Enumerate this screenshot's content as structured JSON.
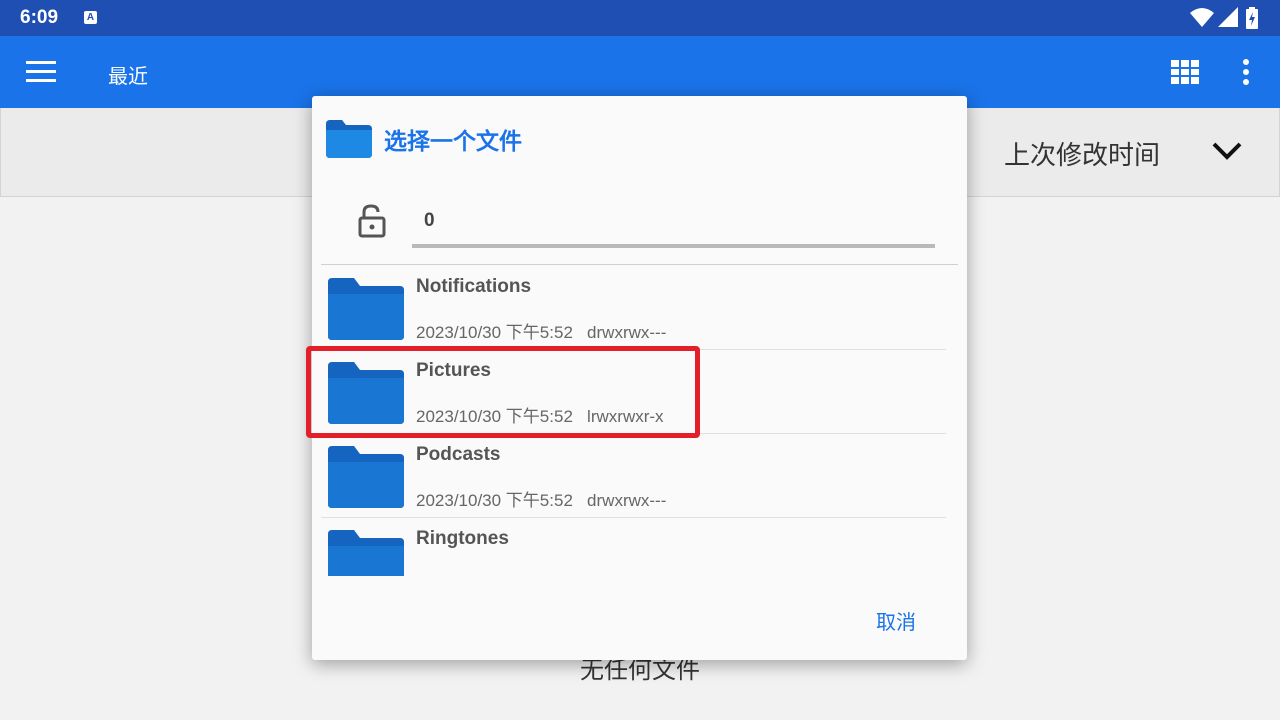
{
  "status_bar": {
    "time": "6:09",
    "notification_icon": "A",
    "icons": [
      "wifi-icon",
      "signal-icon",
      "battery-icon"
    ]
  },
  "app_bar": {
    "title": "最近",
    "icons": [
      "menu-icon",
      "grid-view-icon",
      "more-vert-icon"
    ],
    "color": "#1a73e8"
  },
  "sort_bar": {
    "label": "上次修改时间"
  },
  "background": {
    "empty_text": "无任何文件"
  },
  "dialog": {
    "title": "选择一个文件",
    "path_value": "0",
    "cancel_label": "取消",
    "files": [
      {
        "name": "Notifications",
        "meta": "2023/10/30 下午5:52   drwxrwx---"
      },
      {
        "name": "Pictures",
        "meta": "2023/10/30 下午5:52   lrwxrwxr-x"
      },
      {
        "name": "Podcasts",
        "meta": "2023/10/30 下午5:52   drwxrwx---"
      },
      {
        "name": "Ringtones",
        "meta": ""
      }
    ]
  },
  "colors": {
    "accent": "#1a73e8",
    "status_bar": "#1f4fb2",
    "highlight": "#e3202a"
  }
}
